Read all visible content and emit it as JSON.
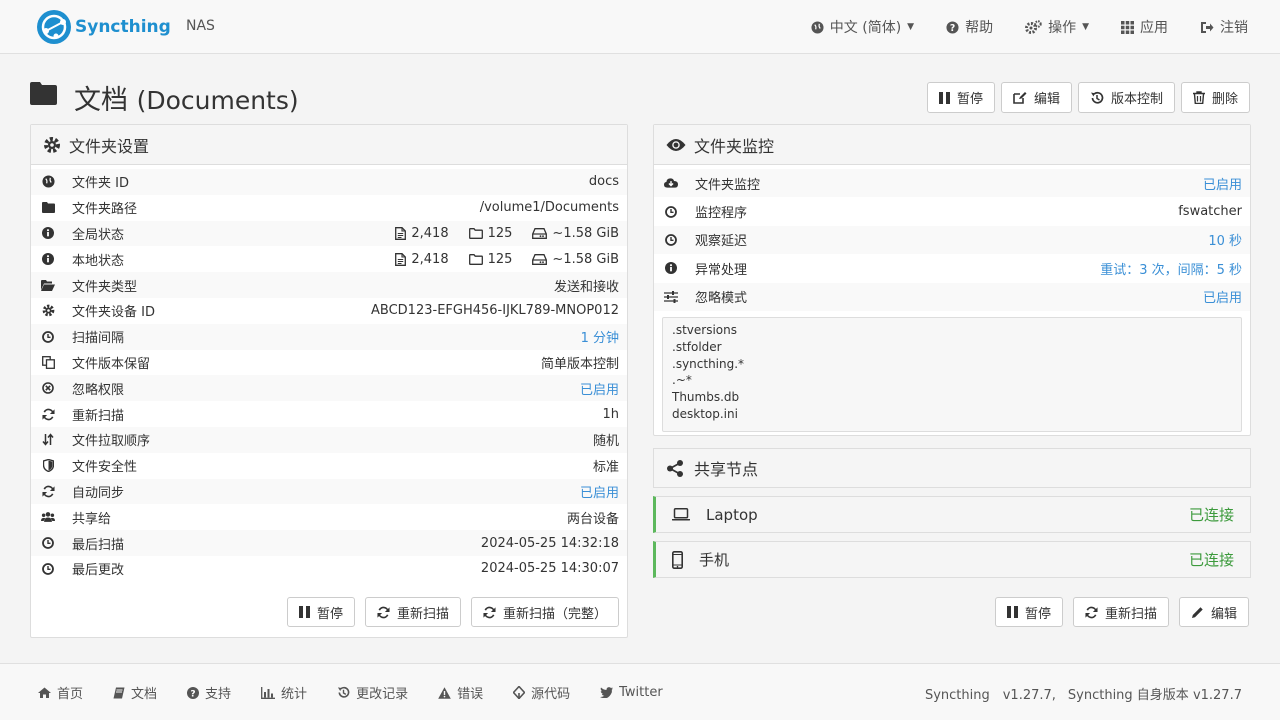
{
  "app": {
    "logo_text": "Syncthing",
    "host": "NAS"
  },
  "nav": {
    "language": "中文 (简体)",
    "help": "帮助",
    "actions": "操作",
    "apps": "应用",
    "logout": "注销"
  },
  "folder": {
    "title": "文档",
    "subtitle": "(Documents)",
    "buttons": {
      "pause": "暂停",
      "edit": "编辑",
      "versioning": "版本控制",
      "delete": "删除"
    }
  },
  "settings": {
    "heading": "文件夹设置",
    "rows": [
      {
        "label": "文件夹 ID",
        "value": "docs",
        "icon": "globe-icon"
      },
      {
        "label": "文件夹路径",
        "value": "/volume1/Documents",
        "icon": "folder-icon"
      },
      {
        "label": "全局状态",
        "files": "2,418",
        "dirs": "125",
        "size": "~1.58 GiB",
        "icon": "info-icon"
      },
      {
        "label": "本地状态",
        "files": "2,418",
        "dirs": "125",
        "size": "~1.58 GiB",
        "icon": "info-icon"
      },
      {
        "label": "文件夹类型",
        "value": "发送和接收",
        "icon": "folder-open-icon"
      },
      {
        "label": "文件夹设备 ID",
        "value": "ABCD123-EFGH456-IJKL789-MNOP012",
        "icon": "gear-icon"
      },
      {
        "label": "扫描间隔",
        "value": "1 分钟",
        "icon": "clock-icon",
        "link": true
      },
      {
        "label": "文件版本保留",
        "value": "简单版本控制",
        "icon": "copy-icon"
      },
      {
        "label": "忽略权限",
        "value": "已启用",
        "icon": "ban-icon",
        "link": true
      },
      {
        "label": "重新扫描",
        "value": "1h",
        "icon": "refresh-icon"
      },
      {
        "label": "文件拉取顺序",
        "value": "随机",
        "icon": "sort-icon"
      },
      {
        "label": "文件安全性",
        "value": "标准",
        "icon": "shield-icon"
      },
      {
        "label": "自动同步",
        "value": "已启用",
        "icon": "refresh-icon",
        "link": true
      },
      {
        "label": "共享给",
        "value": "两台设备",
        "icon": "users-icon"
      },
      {
        "label": "最后扫描",
        "value": "2024-05-25 14:32:18",
        "icon": "clock-icon"
      },
      {
        "label": "最后更改",
        "value": "2024-05-25 14:30:07",
        "icon": "clock-icon"
      }
    ],
    "buttons": {
      "pause": "暂停",
      "rescan": "重新扫描",
      "rescan_full": "重新扫描（完整）"
    }
  },
  "monitor": {
    "heading": "文件夹监控",
    "rows": [
      {
        "label": "文件夹监控",
        "value": "已启用",
        "icon": "cloud-download-icon",
        "link": true
      },
      {
        "label": "监控程序",
        "value": "fswatcher",
        "icon": "clock-icon"
      },
      {
        "label": "观察延迟",
        "value": "10 秒",
        "icon": "clock-icon",
        "link": true
      },
      {
        "label": "异常处理",
        "value": "重试：3 次，间隔：5 秒",
        "icon": "info-icon",
        "link": true
      },
      {
        "label": "忽略模式",
        "value": "已启用",
        "icon": "sliders-icon",
        "link": true
      }
    ],
    "ignore_patterns": [
      ".stversions",
      ".stfolder",
      ".syncthing.*",
      ".~*",
      "Thumbs.db",
      "desktop.ini"
    ]
  },
  "share": {
    "heading": "共享节点",
    "devices": [
      {
        "name": "Laptop",
        "status": "已连接",
        "icon": "laptop-icon"
      },
      {
        "name": "手机",
        "status": "已连接",
        "icon": "mobile-icon"
      }
    ],
    "buttons": {
      "pause": "暂停",
      "rescan": "重新扫描",
      "edit": "编辑"
    }
  },
  "footer": {
    "links": [
      "首页",
      "文档",
      "支持",
      "统计",
      "更改记录",
      "错误",
      "源代码",
      "Twitter"
    ],
    "version": "Syncthing　v1.27.7,",
    "self_version": "Syncthing 自身版本 v1.27.7"
  },
  "colors": {
    "accent": "#1e8fcf",
    "link": "#3a8fd6",
    "connected": "#3c9a3c",
    "connected_border": "#5cb85c"
  }
}
